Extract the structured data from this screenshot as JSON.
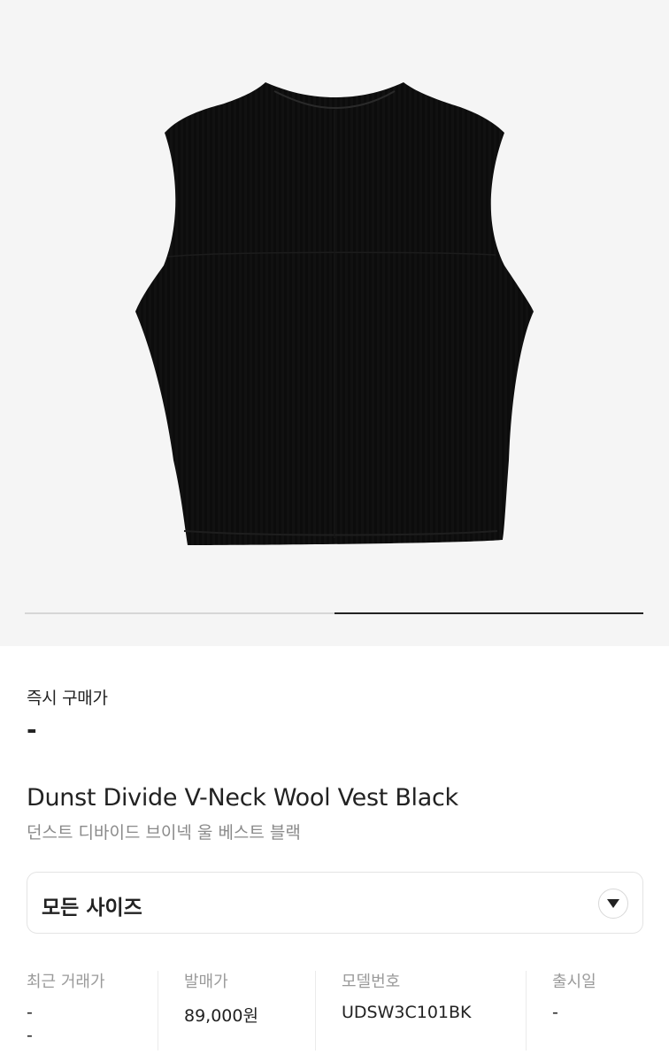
{
  "gallery": {
    "image_alt": "black knit vest",
    "slide_progress": 0.5,
    "slide_count": 2,
    "active_slide": 2
  },
  "instant_buy": {
    "label": "즉시 구매가",
    "price": "-"
  },
  "product": {
    "name_en": "Dunst Divide V-Neck Wool Vest Black",
    "name_ko": "던스트 디바이드 브이넥 울 베스트 블랙"
  },
  "size_select": {
    "value": "모든 사이즈",
    "icon": "chevron-down-icon"
  },
  "details": [
    {
      "label": "최근 거래가",
      "value": "-",
      "extra": "-"
    },
    {
      "label": "발매가",
      "value": "89,000원"
    },
    {
      "label": "모델번호",
      "value": "UDSW3C101BK"
    },
    {
      "label": "출시일",
      "value": "-"
    }
  ],
  "colors": {
    "accent": "#222222",
    "muted": "#8a8a8a",
    "gallery_bg": "#f5f5f5"
  }
}
